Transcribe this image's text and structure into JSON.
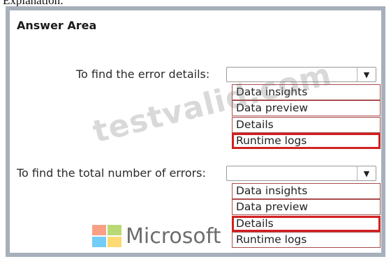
{
  "caption": "Explanation:",
  "answer_area_title": "Answer Area",
  "questions": [
    {
      "label": "To find the error details:",
      "options": [
        "Data insights",
        "Data preview",
        "Details",
        "Runtime logs"
      ],
      "selected_index": 3
    },
    {
      "label": "To find the total number of errors:",
      "options": [
        "Data insights",
        "Data preview",
        "Details",
        "Runtime logs"
      ],
      "selected_index": 2
    }
  ],
  "watermark_text": "testvalid.com",
  "brand": {
    "name": "Microsoft",
    "logo_colors": [
      "#f25022",
      "#7fba00",
      "#00a4ef",
      "#ffb900"
    ]
  },
  "colors": {
    "frame": "#a7b0ba",
    "selected_border": "#d12020",
    "option_border": "#a94c4c"
  },
  "icons": {
    "dropdown": "chevron-down-icon"
  }
}
